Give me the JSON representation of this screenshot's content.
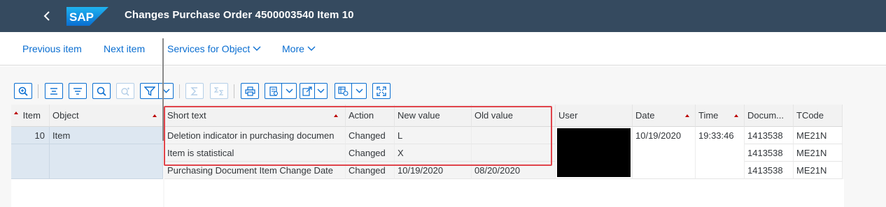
{
  "shell": {
    "title": "Changes Purchase Order 4500003540 Item 10",
    "logo_text": "SAP",
    "brand_color": "#354a5f"
  },
  "nav": {
    "previous": "Previous item",
    "next": "Next item",
    "services": "Services for Object",
    "more": "More"
  },
  "toolbar": {
    "buttons": [
      "zoom-icon",
      "align-top-icon",
      "filter-list-icon",
      "search-icon",
      "find-next-icon",
      "filter-icon",
      "sum-icon",
      "subtotal-icon",
      "print-icon",
      "view-icon",
      "export-icon",
      "layout-icon",
      "fullscreen-icon"
    ]
  },
  "grid": {
    "columns": {
      "item": "Item",
      "object": "Object",
      "short_text": "Short text",
      "action": "Action",
      "new_value": "New value",
      "old_value": "Old value",
      "user": "User",
      "date": "Date",
      "time": "Time",
      "document": "Docum...",
      "tcode": "TCode"
    },
    "fixed_rows": [
      {
        "item": "10",
        "object": "Item"
      }
    ],
    "rows": [
      {
        "short_text": "Deletion indicator in purchasing documen",
        "action": "Changed",
        "new_value": "L",
        "old_value": "",
        "date": "10/19/2020",
        "time": "19:33:46",
        "document": "1413538",
        "tcode": "ME21N"
      },
      {
        "short_text": "Item is statistical",
        "action": "Changed",
        "new_value": "X",
        "old_value": "",
        "date": "",
        "time": "",
        "document": "1413538",
        "tcode": "ME21N"
      },
      {
        "short_text": "Purchasing Document Item Change Date",
        "action": "Changed",
        "new_value": "10/19/2020",
        "old_value": "08/20/2020",
        "date": "",
        "time": "",
        "document": "1413538",
        "tcode": "ME21N"
      }
    ]
  },
  "colors": {
    "accent": "#0a6ed1",
    "highlight": "#e0444b",
    "sort_indicator": "#bb0000"
  }
}
